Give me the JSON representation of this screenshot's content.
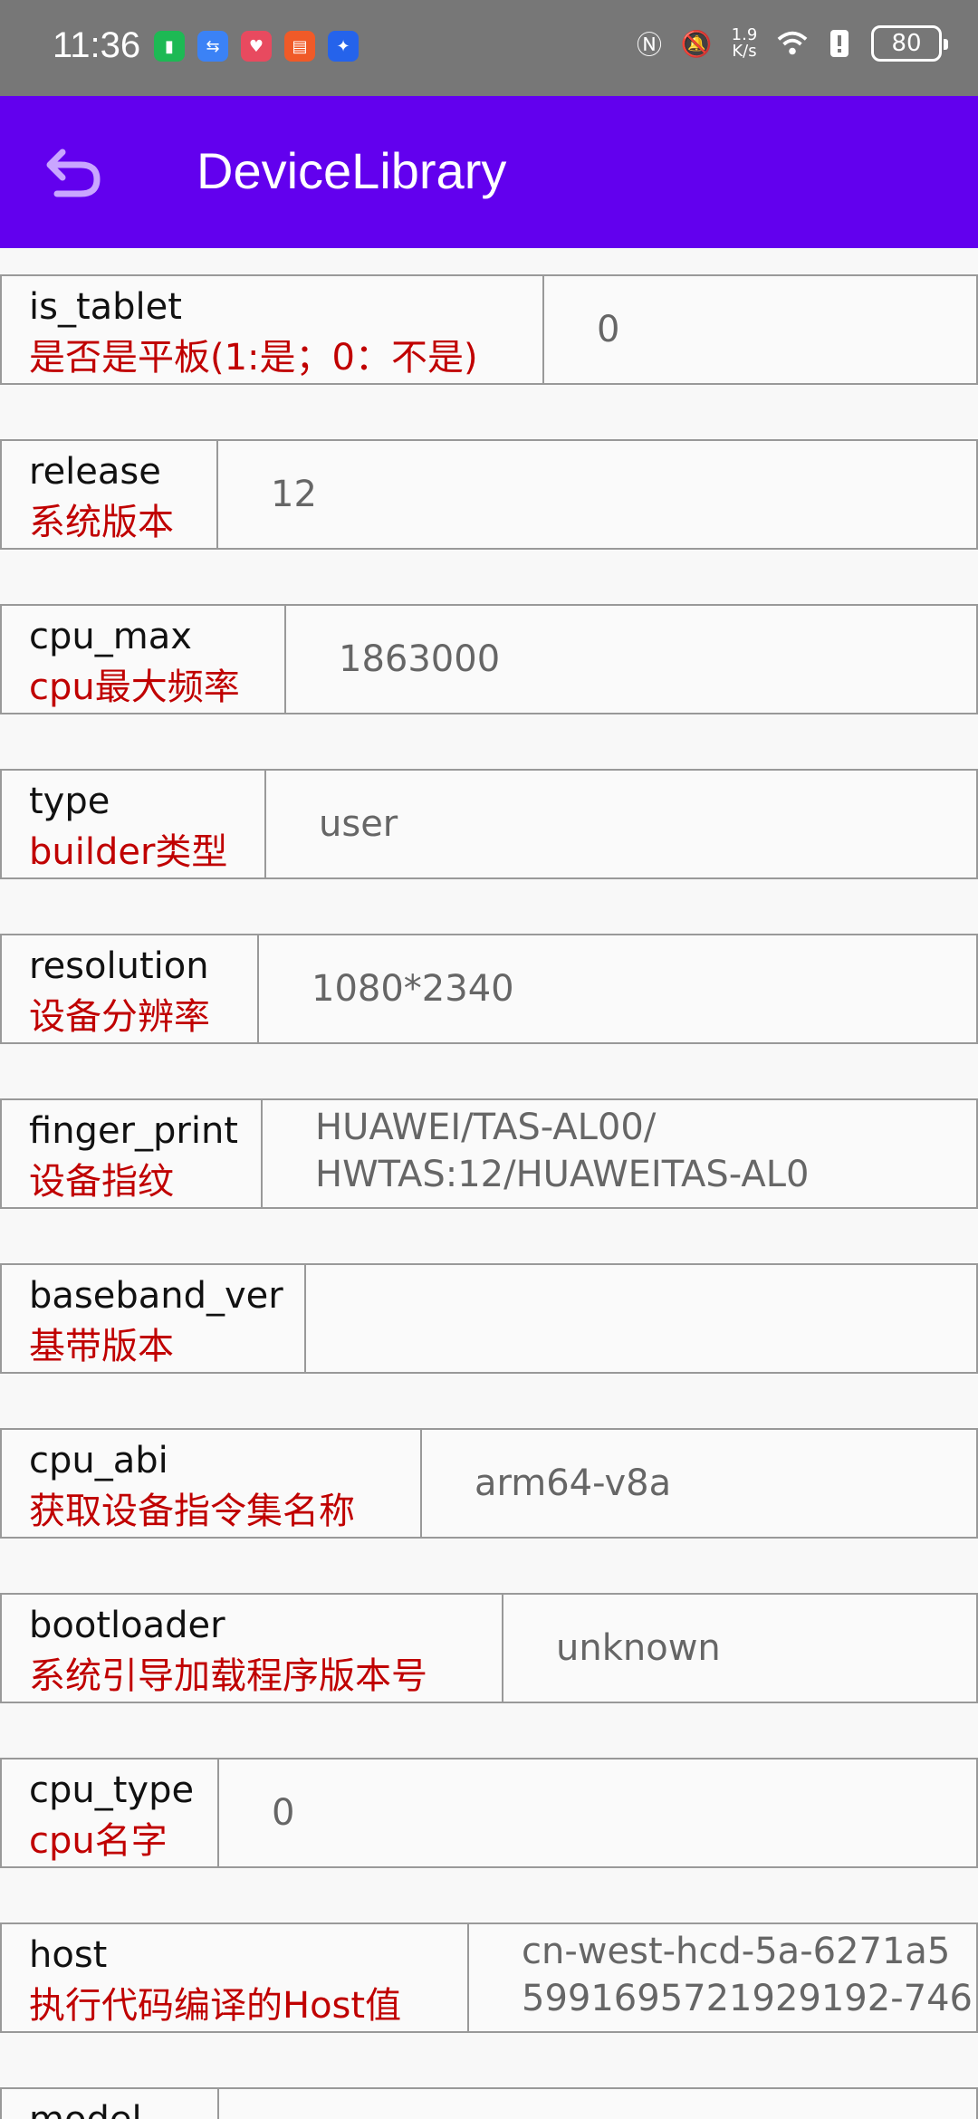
{
  "status": {
    "time": "11:36",
    "speed_top": "1.9",
    "speed_unit": "K/s",
    "battery": "80"
  },
  "appbar": {
    "title": "DeviceLibrary"
  },
  "rows": [
    {
      "key": "is_tablet",
      "desc": "是否是平板(1:是；0：不是)",
      "value": "0"
    },
    {
      "key": "release",
      "desc": "系统版本",
      "value": "12"
    },
    {
      "key": "cpu_max",
      "desc": "cpu最大频率",
      "value": "1863000"
    },
    {
      "key": "type",
      "desc": "builder类型",
      "value": "user"
    },
    {
      "key": "resolution",
      "desc": "设备分辨率",
      "value": "1080*2340"
    },
    {
      "key": "finger_print",
      "desc": "设备指纹",
      "value": "HUAWEI/TAS-AL00/\nHWTAS:12/HUAWEITAS-AL0"
    },
    {
      "key": "baseband_ver",
      "desc": "基带版本",
      "value": ""
    },
    {
      "key": "cpu_abi",
      "desc": "获取设备指令集名称",
      "value": "arm64-v8a"
    },
    {
      "key": "bootloader",
      "desc": "系统引导加载程序版本号",
      "value": "unknown"
    },
    {
      "key": "cpu_type",
      "desc": "cpu名字",
      "value": "0"
    },
    {
      "key": "host",
      "desc": "执行代码编译的Host值",
      "value": "cn-west-hcd-5a-6271a5\n5991695721929192-746"
    },
    {
      "key": "model",
      "desc": "",
      "value": ""
    }
  ]
}
